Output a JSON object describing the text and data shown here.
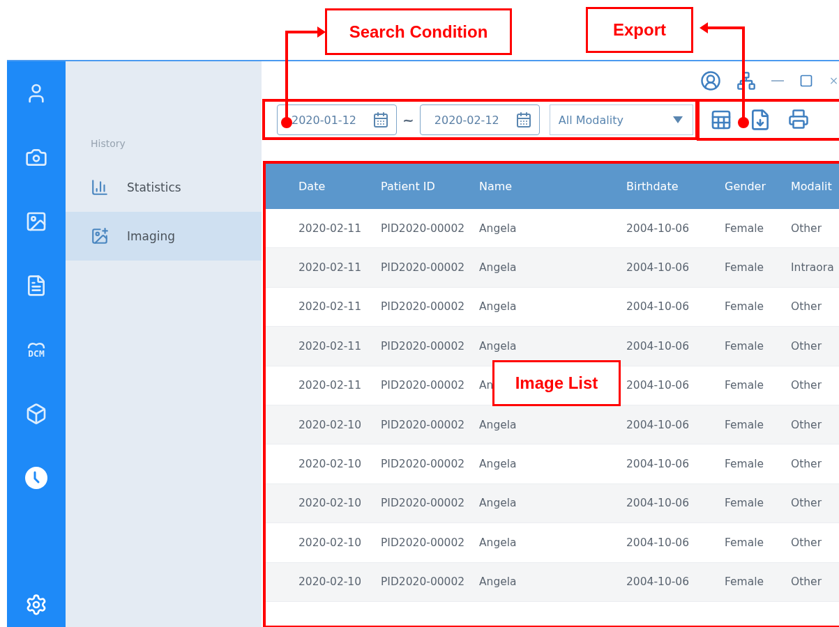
{
  "annotations": {
    "search_condition": "Search Condition",
    "export": "Export",
    "image_list": "Image List"
  },
  "nav_rail": [
    {
      "kind": "icon",
      "selected": false
    },
    {
      "kind": "icon",
      "selected": false
    },
    {
      "kind": "icon",
      "selected": false
    },
    {
      "kind": "icon",
      "selected": false
    },
    {
      "kind": "dcm",
      "label": "DCM",
      "selected": false
    },
    {
      "kind": "icon",
      "selected": false
    },
    {
      "kind": "icon",
      "selected": true
    }
  ],
  "panel": {
    "heading": "History",
    "items": [
      {
        "label": "Statistics",
        "selected": false
      },
      {
        "label": "Imaging",
        "selected": true
      }
    ]
  },
  "search": {
    "date_from": "2020-01-12",
    "separator": "~",
    "date_to": "2020-02-12",
    "modality": "All Modality"
  },
  "table": {
    "columns": [
      "Date",
      "Patient ID",
      "Name",
      "Birthdate",
      "Gender",
      "Modalit"
    ],
    "rows": [
      [
        "2020-02-11",
        "PID2020-00002",
        "Angela",
        "2004-10-06",
        "Female",
        "Other"
      ],
      [
        "2020-02-11",
        "PID2020-00002",
        "Angela",
        "2004-10-06",
        "Female",
        "Intraora"
      ],
      [
        "2020-02-11",
        "PID2020-00002",
        "Angela",
        "2004-10-06",
        "Female",
        "Other"
      ],
      [
        "2020-02-11",
        "PID2020-00002",
        "Angela",
        "2004-10-06",
        "Female",
        "Other"
      ],
      [
        "2020-02-11",
        "PID2020-00002",
        "An",
        "2004-10-06",
        "Female",
        "Other"
      ],
      [
        "2020-02-10",
        "PID2020-00002",
        "Angela",
        "2004-10-06",
        "Female",
        "Other"
      ],
      [
        "2020-02-10",
        "PID2020-00002",
        "Angela",
        "2004-10-06",
        "Female",
        "Other"
      ],
      [
        "2020-02-10",
        "PID2020-00002",
        "Angela",
        "2004-10-06",
        "Female",
        "Other"
      ],
      [
        "2020-02-10",
        "PID2020-00002",
        "Angela",
        "2004-10-06",
        "Female",
        "Other"
      ],
      [
        "2020-02-10",
        "PID2020-00002",
        "Angela",
        "2004-10-06",
        "Female",
        "Other"
      ]
    ]
  }
}
